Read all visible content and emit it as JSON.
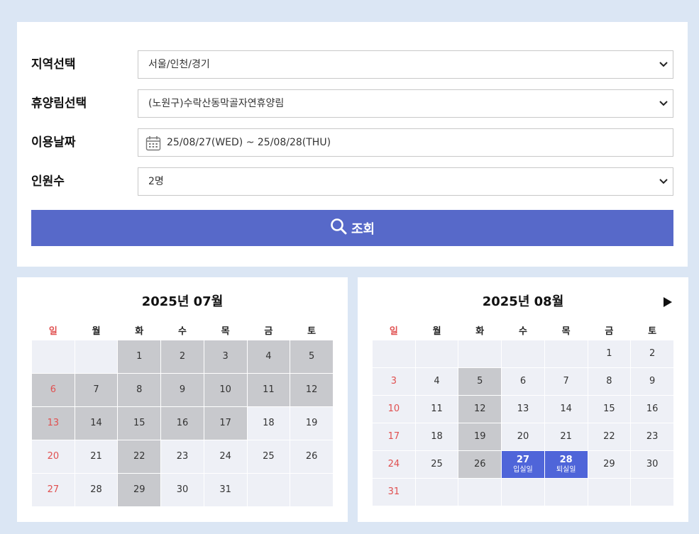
{
  "form": {
    "region_label": "지역선택",
    "region_value": "서울/인천/경기",
    "forest_label": "휴양림선택",
    "forest_value": "(노원구)수락산동막골자연휴양림",
    "date_label": "이용날짜",
    "date_value": "25/08/27(WED) ~ 25/08/28(THU)",
    "people_label": "인원수",
    "people_value": "2명",
    "search_label": "조회"
  },
  "weekdays": [
    "일",
    "월",
    "화",
    "수",
    "목",
    "금",
    "토"
  ],
  "calendars": [
    {
      "title": "2025년 07월",
      "weeks": [
        [
          {
            "d": "",
            "s": "empty"
          },
          {
            "d": "",
            "s": "empty"
          },
          {
            "d": "1",
            "s": "full"
          },
          {
            "d": "2",
            "s": "full"
          },
          {
            "d": "3",
            "s": "full"
          },
          {
            "d": "4",
            "s": "full"
          },
          {
            "d": "5",
            "s": "full"
          }
        ],
        [
          {
            "d": "6",
            "s": "full"
          },
          {
            "d": "7",
            "s": "full"
          },
          {
            "d": "8",
            "s": "full"
          },
          {
            "d": "9",
            "s": "full"
          },
          {
            "d": "10",
            "s": "full"
          },
          {
            "d": "11",
            "s": "full"
          },
          {
            "d": "12",
            "s": "full"
          }
        ],
        [
          {
            "d": "13",
            "s": "full"
          },
          {
            "d": "14",
            "s": "full"
          },
          {
            "d": "15",
            "s": "full"
          },
          {
            "d": "16",
            "s": "full"
          },
          {
            "d": "17",
            "s": "full"
          },
          {
            "d": "18",
            "s": "avail"
          },
          {
            "d": "19",
            "s": "avail"
          }
        ],
        [
          {
            "d": "20",
            "s": "avail"
          },
          {
            "d": "21",
            "s": "avail"
          },
          {
            "d": "22",
            "s": "full"
          },
          {
            "d": "23",
            "s": "avail"
          },
          {
            "d": "24",
            "s": "avail"
          },
          {
            "d": "25",
            "s": "avail"
          },
          {
            "d": "26",
            "s": "avail"
          }
        ],
        [
          {
            "d": "27",
            "s": "avail"
          },
          {
            "d": "28",
            "s": "avail"
          },
          {
            "d": "29",
            "s": "full"
          },
          {
            "d": "30",
            "s": "avail"
          },
          {
            "d": "31",
            "s": "avail"
          },
          {
            "d": "",
            "s": "empty"
          },
          {
            "d": "",
            "s": "empty"
          }
        ]
      ]
    },
    {
      "title": "2025년 08월",
      "weeks": [
        [
          {
            "d": "",
            "s": "empty"
          },
          {
            "d": "",
            "s": "empty"
          },
          {
            "d": "",
            "s": "empty"
          },
          {
            "d": "",
            "s": "empty"
          },
          {
            "d": "",
            "s": "empty"
          },
          {
            "d": "1",
            "s": "avail"
          },
          {
            "d": "2",
            "s": "avail"
          }
        ],
        [
          {
            "d": "3",
            "s": "avail"
          },
          {
            "d": "4",
            "s": "avail"
          },
          {
            "d": "5",
            "s": "full"
          },
          {
            "d": "6",
            "s": "avail"
          },
          {
            "d": "7",
            "s": "avail"
          },
          {
            "d": "8",
            "s": "avail"
          },
          {
            "d": "9",
            "s": "avail"
          }
        ],
        [
          {
            "d": "10",
            "s": "avail"
          },
          {
            "d": "11",
            "s": "avail"
          },
          {
            "d": "12",
            "s": "full"
          },
          {
            "d": "13",
            "s": "avail"
          },
          {
            "d": "14",
            "s": "avail"
          },
          {
            "d": "15",
            "s": "avail"
          },
          {
            "d": "16",
            "s": "avail"
          }
        ],
        [
          {
            "d": "17",
            "s": "avail"
          },
          {
            "d": "18",
            "s": "avail"
          },
          {
            "d": "19",
            "s": "full"
          },
          {
            "d": "20",
            "s": "avail"
          },
          {
            "d": "21",
            "s": "avail"
          },
          {
            "d": "22",
            "s": "avail"
          },
          {
            "d": "23",
            "s": "avail"
          }
        ],
        [
          {
            "d": "24",
            "s": "avail"
          },
          {
            "d": "25",
            "s": "avail"
          },
          {
            "d": "26",
            "s": "full"
          },
          {
            "d": "27",
            "s": "sel",
            "sub": "입실일"
          },
          {
            "d": "28",
            "s": "sel",
            "sub": "퇴실일"
          },
          {
            "d": "29",
            "s": "avail"
          },
          {
            "d": "30",
            "s": "avail"
          }
        ],
        [
          {
            "d": "31",
            "s": "avail"
          },
          {
            "d": "",
            "s": "empty"
          },
          {
            "d": "",
            "s": "empty"
          },
          {
            "d": "",
            "s": "empty"
          },
          {
            "d": "",
            "s": "empty"
          },
          {
            "d": "",
            "s": "empty"
          },
          {
            "d": "",
            "s": "empty"
          }
        ]
      ]
    }
  ],
  "colors": {
    "accent": "#5769c9",
    "selected": "#4f65d9",
    "sunday": "#e05050",
    "booked": "#c8c9cd",
    "available": "#eef0f6"
  },
  "icons": {
    "search": "magnifier-icon",
    "date": "calendar-icon",
    "next": "triangle-right-icon",
    "select": "chevron-down-icon"
  }
}
